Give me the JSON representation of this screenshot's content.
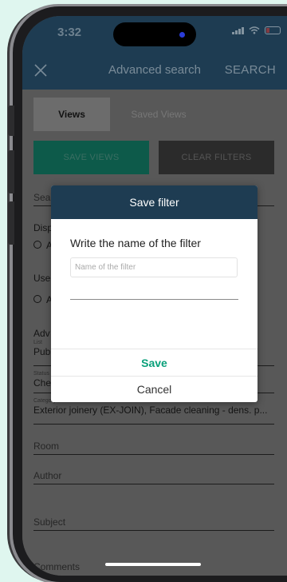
{
  "status": {
    "time": "3:32"
  },
  "header": {
    "title": "Advanced search",
    "search_label": "SEARCH"
  },
  "tabs": [
    {
      "label": "Views"
    },
    {
      "label": "Saved Views"
    }
  ],
  "actions": {
    "save_views": "SAVE VIEWS",
    "clear_filters": "CLEAR FILTERS"
  },
  "form": {
    "search_placeholder": "Search",
    "display_label": "Disp",
    "display_option": "A",
    "use_label": "Use",
    "use_option": "A",
    "advanced_label": "Adv",
    "list_label": "List",
    "list_value": "Pub",
    "status_label": "Status",
    "status_value": "Che",
    "category_label": "Category",
    "category_value": "Exterior joinery (EX-JOIN), Facade cleaning - dens. p...",
    "room_label": "Room",
    "author_label": "Author",
    "subject_label": "Subject",
    "comments_label": "Comments"
  },
  "dialog": {
    "title": "Save filter",
    "prompt": "Write the name of the filter",
    "input_placeholder": "Name of the filter",
    "input_value": "",
    "save_label": "Save",
    "cancel_label": "Cancel"
  },
  "colors": {
    "primary": "#1e3c52",
    "accent": "#0aa07a",
    "save_views_button": "#0d5a4a",
    "clear_filters_button": "#2b2b2b",
    "overlay": "#585858"
  }
}
